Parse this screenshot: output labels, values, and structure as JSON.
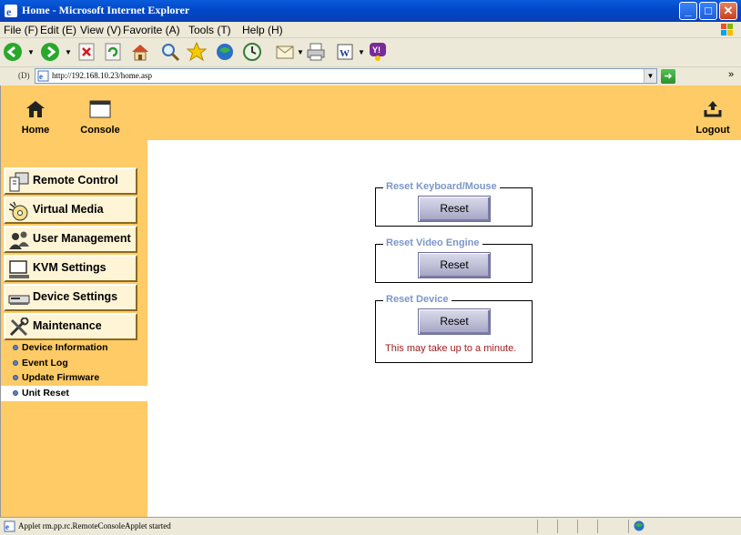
{
  "window": {
    "title": "Home - Microsoft Internet Explorer",
    "minimize": "_",
    "maximize": "□",
    "close": "✕"
  },
  "menubar": {
    "items": [
      "File (F)",
      "Edit (E)",
      "View (V)",
      "Favorite (A)",
      "Tools (T)",
      "Help (H)"
    ]
  },
  "toolbar": {
    "icons": [
      "back-icon",
      "forward-icon",
      "stop-icon",
      "refresh-icon",
      "home-icon",
      "search-icon",
      "favorites-icon",
      "media-icon",
      "history-icon",
      "mail-icon",
      "print-icon",
      "word-icon",
      "messenger-icon"
    ]
  },
  "address": {
    "label": "(D)",
    "url": "http://192.168.10.23/home.asp",
    "more": "»"
  },
  "header": {
    "home_label": "Home",
    "console_label": "Console",
    "logout_label": "Logout"
  },
  "sidebar": {
    "menu": [
      {
        "label": "Remote Control",
        "icon": "remote-control-icon"
      },
      {
        "label": "Virtual Media",
        "icon": "virtual-media-icon"
      },
      {
        "label": "User Management",
        "icon": "user-management-icon"
      },
      {
        "label": "KVM Settings",
        "icon": "kvm-settings-icon"
      },
      {
        "label": "Device Settings",
        "icon": "device-settings-icon"
      },
      {
        "label": "Maintenance",
        "icon": "maintenance-icon"
      }
    ],
    "submenu": [
      {
        "label": "Device Information",
        "active": false
      },
      {
        "label": "Event Log",
        "active": false
      },
      {
        "label": "Update Firmware",
        "active": false
      },
      {
        "label": "Unit Reset",
        "active": true
      }
    ]
  },
  "main": {
    "groups": [
      {
        "legend": "Reset Keyboard/Mouse",
        "button": "Reset"
      },
      {
        "legend": "Reset Video Engine",
        "button": "Reset"
      },
      {
        "legend": "Reset Device",
        "button": "Reset",
        "note": "This may take up to a minute."
      }
    ]
  },
  "status": {
    "text": "Applet rm.pp.rc.RemoteConsoleApplet started"
  },
  "colors": {
    "accent": "#fecb66",
    "legend": "#7b96c8",
    "note": "#9c1a1a"
  }
}
